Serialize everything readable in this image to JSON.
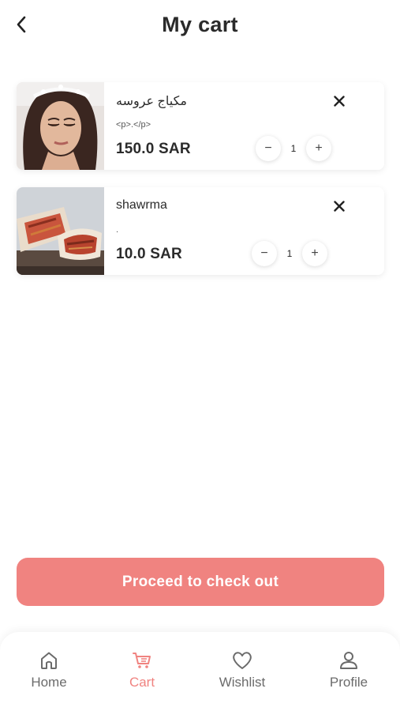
{
  "header": {
    "title": "My cart",
    "back_icon": "chevron-left-icon"
  },
  "cart": {
    "items": [
      {
        "name": "مكياج عروسه",
        "description": "<p>.</p>",
        "price": "150.0 SAR",
        "quantity": "1",
        "image": "bride-makeup-photo"
      },
      {
        "name": "shawrma",
        "description": ".",
        "price": "10.0 SAR",
        "quantity": "1",
        "image": "shawarma-photo"
      }
    ]
  },
  "stepper": {
    "minus": "−",
    "plus": "+"
  },
  "checkout": {
    "label": "Proceed to check out",
    "color": "#f08380"
  },
  "nav": {
    "items": [
      {
        "label": "Home",
        "icon": "home-icon"
      },
      {
        "label": "Cart",
        "icon": "cart-icon",
        "active": true
      },
      {
        "label": "Wishlist",
        "icon": "heart-icon"
      },
      {
        "label": "Profile",
        "icon": "user-icon"
      }
    ],
    "active_color": "#f08380",
    "inactive_color": "#6b6b6b"
  }
}
